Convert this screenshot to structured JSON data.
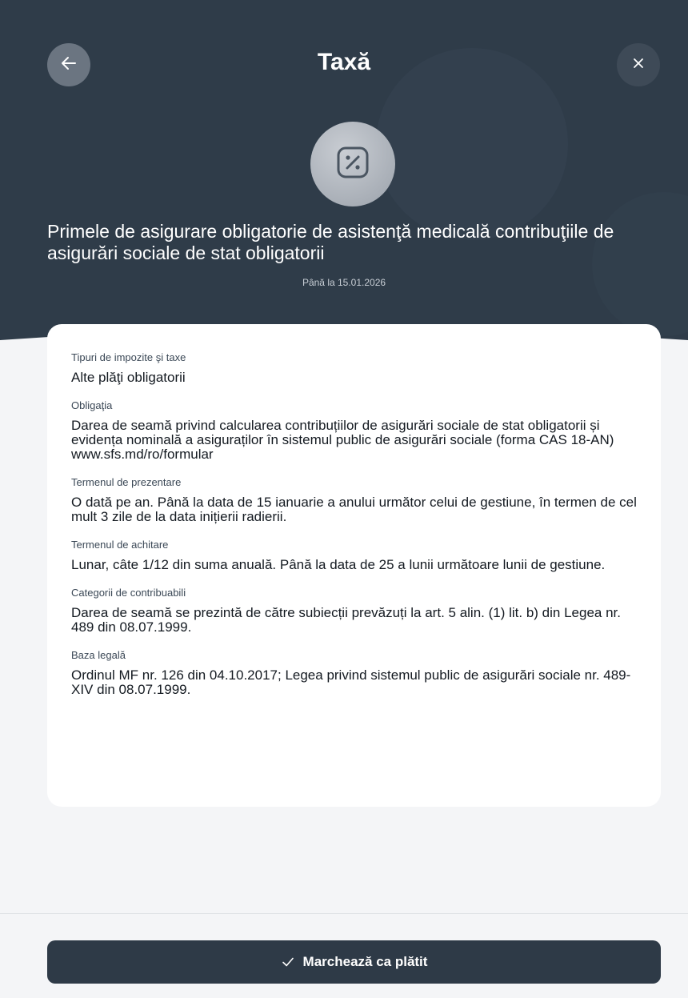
{
  "header": {
    "title": "Taxă",
    "back_icon": "arrow-left-icon",
    "close_icon": "close-icon",
    "badge_icon": "percent-badge-icon"
  },
  "tax": {
    "subject": "Primele de asigurare obligatorie de asistenţă medicală contribuţiile de asigurări sociale de stat obligatorii",
    "deadline": "Până la 15.01.2026"
  },
  "details": [
    {
      "label": "Tipuri de impozite şi taxe",
      "value": "Alte plăţi obligatorii"
    },
    {
      "label": "Obligaţia",
      "value": "Darea de seamă privind calcularea contribuțiilor de asigurări sociale de stat obligatorii și evidența nominală a asiguraților în sistemul public de asigurări sociale (forma CAS 18-AN) www.sfs.md/ro/formular"
    },
    {
      "label": "Termenul de prezentare",
      "value": "O dată pe an. Până la data de 15 ianuarie a anului următor celui de gestiune, în termen de cel mult 3 zile de la data inițierii radierii."
    },
    {
      "label": "Termenul de achitare",
      "value": "Lunar, câte 1/12 din suma anuală. Până la data de 25 a lunii următoare lunii de gestiune."
    },
    {
      "label": "Categorii de contribuabili",
      "value": "Darea de seamă se prezintă de către subiecții prevăzuți la art. 5 alin. (1) lit. b) din Legea nr. 489 din 08.07.1999."
    },
    {
      "label": "Baza legală",
      "value": "Ordinul MF nr. 126 din 04.10.2017; Legea privind sistemul public de asigurări sociale nr. 489-XIV din 08.07.1999."
    }
  ],
  "footer": {
    "mark_paid_label": "Marchează ca plătit",
    "check_icon": "check-icon"
  },
  "colors": {
    "header_bg": "#2f3c49",
    "button_bg": "#2e3a47",
    "card_bg": "#ffffff",
    "page_bg": "#f4f5f7"
  }
}
